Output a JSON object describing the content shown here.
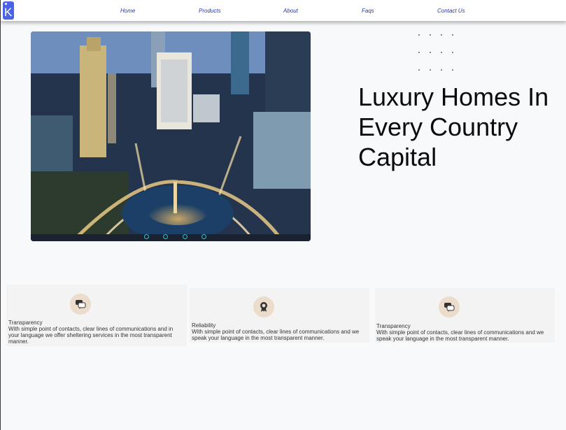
{
  "nav": {
    "logo_letter": "K",
    "items": [
      {
        "label": "Home"
      },
      {
        "label": "Products"
      },
      {
        "label": "About"
      },
      {
        "label": "Faqs"
      },
      {
        "label": "Contact Us"
      }
    ]
  },
  "hero": {
    "image_description_icon": "city-skyline-photo",
    "slider_count": 4,
    "headline": "Luxury Homes In Every Country Capital"
  },
  "features": [
    {
      "icon": "chat-bubbles-icon",
      "title": "Transparency",
      "description": "With simple point of contacts, clear lines of communications and in your language we offer sheltering services in the most transparent manner."
    },
    {
      "icon": "award-badge-icon",
      "title": "Reliability",
      "description": "With simple point of contacts, clear lines of communications and we speak your language in the most transparent manner."
    },
    {
      "icon": "chat-bubbles-icon",
      "title": "Transparency",
      "description": "With simple point of contacts, clear lines of communications and we speak your language in the most transparent manner."
    }
  ],
  "colors": {
    "accent": "#4a63e8",
    "nav_link": "#2438a8",
    "icon_bg": "#ecdccb",
    "slider_dot": "#28c2c9"
  }
}
